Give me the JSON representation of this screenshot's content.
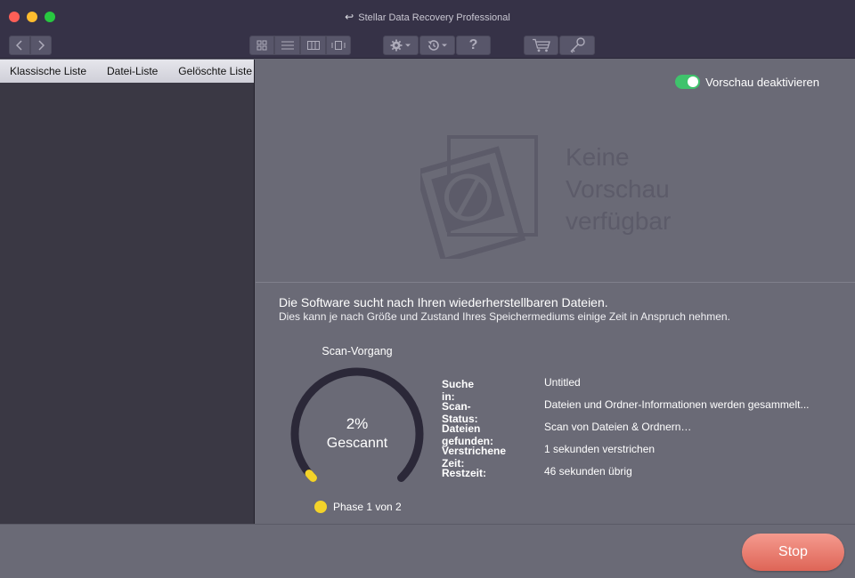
{
  "window": {
    "title": "Stellar Data Recovery Professional",
    "title_icon": "back-arrow-icon"
  },
  "toolbar": {
    "buttons": [
      {
        "name": "nav-back",
        "icon": "chevron-left-icon"
      },
      {
        "name": "nav-forward",
        "icon": "chevron-right-icon"
      },
      {
        "name": "view-icons",
        "icon": "grid-icon"
      },
      {
        "name": "view-list",
        "icon": "list-icon"
      },
      {
        "name": "view-columns",
        "icon": "columns-icon"
      },
      {
        "name": "view-coverflow",
        "icon": "coverflow-icon"
      },
      {
        "name": "settings",
        "icon": "gear-icon"
      },
      {
        "name": "history",
        "icon": "history-icon"
      },
      {
        "name": "help",
        "icon": "question-icon",
        "label": "?"
      },
      {
        "name": "cart",
        "icon": "cart-icon"
      },
      {
        "name": "activate",
        "icon": "key-icon"
      }
    ]
  },
  "sidebar": {
    "tabs": [
      "Klassische Liste",
      "Datei-Liste",
      "Gelöschte Liste"
    ]
  },
  "preview": {
    "toggle_label": "Vorschau deaktivieren",
    "toggle_on": true,
    "no_preview_lines": [
      "Keine",
      "Vorschau",
      "verfügbar"
    ]
  },
  "scan": {
    "headline": "Die Software sucht nach Ihren wiederherstellbaren Dateien.",
    "subline": "Dies kann je nach Größe und Zustand Ihres Speichermediums einige Zeit in Anspruch nehmen.",
    "gauge_title": "Scan-Vorgang",
    "percent_text": "2%",
    "percent_value": 2,
    "status_label": "Gescannt",
    "phase": "Phase 1 von 2",
    "info": [
      {
        "key": "Suche in:",
        "value": "Untitled"
      },
      {
        "key": "Scan-Status:",
        "value": "Dateien und Ordner-Informationen werden gesammelt..."
      },
      {
        "key": "Dateien gefunden:",
        "value": "Scan von Dateien & Ordnern…"
      },
      {
        "key": "Verstrichene Zeit:",
        "value": "1 sekunden verstrichen"
      },
      {
        "key": "Restzeit:",
        "value": "46 sekunden übrig"
      }
    ]
  },
  "footer": {
    "stop_label": "Stop"
  },
  "colors": {
    "accent_toggle": "#3fc36c",
    "stop_button": "#e8766a",
    "phase_dot": "#f3d32a",
    "gauge_track": "#2b2838"
  }
}
